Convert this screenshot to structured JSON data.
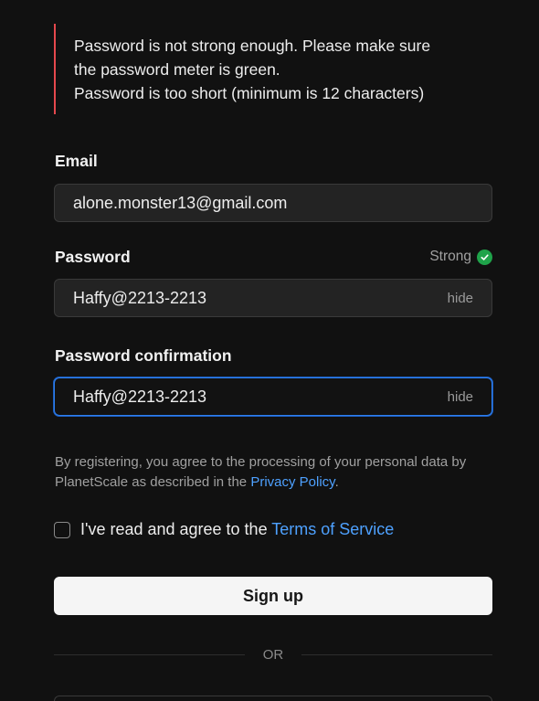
{
  "errors": [
    "Password is not strong enough. Please make sure",
    "the password meter is green.",
    "Password is too short (minimum is 12 characters)"
  ],
  "email": {
    "label": "Email",
    "value": "alone.monster13@gmail.com"
  },
  "password": {
    "label": "Password",
    "strength_label": "Strong",
    "strength_color": "#1fa34a",
    "value": "Haffy@2213-2213",
    "toggle_label": "hide"
  },
  "password_confirmation": {
    "label": "Password confirmation",
    "value": "Haffy@2213-2213",
    "toggle_label": "hide",
    "focused": true
  },
  "legal": {
    "text_before": "By registering, you agree to the processing of your personal data by PlanetScale as described in the ",
    "link": "Privacy Policy",
    "text_after": "."
  },
  "terms": {
    "checked": false,
    "text": "I've read and agree to the ",
    "link": "Terms of Service"
  },
  "signup_label": "Sign up",
  "divider_label": "OR",
  "colors": {
    "background": "#111111",
    "error_accent": "#e5484d",
    "link": "#4ea1ff",
    "focus_ring": "#2d7ff0"
  }
}
